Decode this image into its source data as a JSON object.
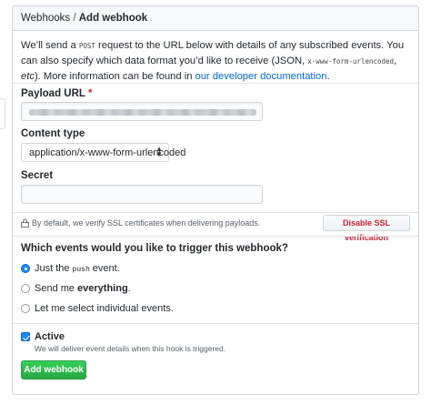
{
  "breadcrumb": {
    "parent": "Webhooks",
    "separator": "/",
    "current": "Add webhook"
  },
  "intro": {
    "part1": "We’ll send a ",
    "code1": "POST",
    "part2": " request to the URL below with details of any subscribed events. You can also specify which data format you’d like to receive (JSON, ",
    "code2": "x-www-form-urlencoded",
    "part3": ", ",
    "etc": "etc",
    "part4": "). More information can be found in ",
    "link": "our developer documentation",
    "part5": "."
  },
  "payload_url": {
    "label": "Payload URL",
    "required_mark": "*",
    "value": ""
  },
  "content_type": {
    "label": "Content type",
    "selected": "application/x-www-form-urlencoded"
  },
  "secret": {
    "label": "Secret",
    "value": ""
  },
  "ssl": {
    "note": "By default, we verify SSL certificates when delivering payloads.",
    "button": "Disable SSL verification"
  },
  "events": {
    "question": "Which events would you like to trigger this webhook?",
    "options": [
      {
        "pre": "Just the",
        "code": "push",
        "post": "event.",
        "checked": true
      },
      {
        "pre": "Send me",
        "bold": "everything",
        "post": ".",
        "checked": false
      },
      {
        "text": "Let me select individual events.",
        "checked": false
      }
    ]
  },
  "active": {
    "label": "Active",
    "checked": true,
    "note": "We will deliver event details when this hook is triggered."
  },
  "submit": {
    "label": "Add webhook"
  },
  "colors": {
    "primary_green": "#28a745",
    "danger_red": "#cb2431",
    "link_blue": "#0366d6",
    "radio_blue": "#2188ff"
  }
}
